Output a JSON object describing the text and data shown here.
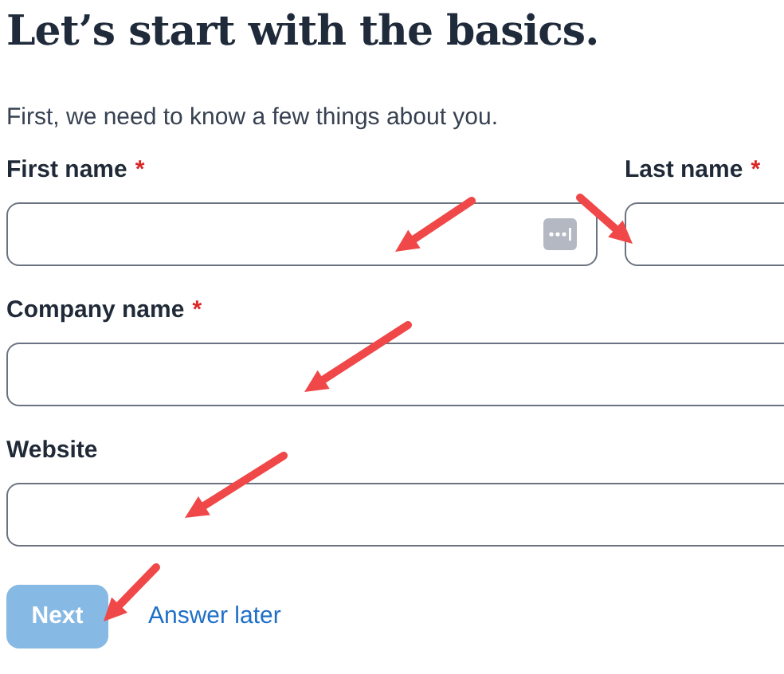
{
  "heading": "Let’s start with the basics.",
  "subtitle": "First, we need to know a few things about you.",
  "rows": [
    [
      {
        "label": "First name",
        "marker": "*",
        "autofill_icon": true
      },
      {
        "label": "Last name",
        "marker": "*"
      }
    ],
    [
      {
        "label": "Company name",
        "marker": "*"
      }
    ],
    [
      {
        "label": "Website"
      }
    ]
  ],
  "next_button": {
    "label": "Next",
    "disabled": true
  },
  "later_link": "Answer later"
}
